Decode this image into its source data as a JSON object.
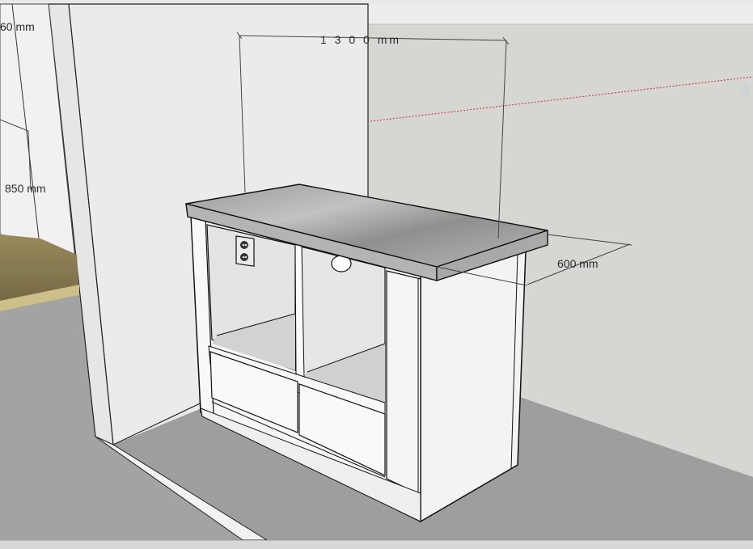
{
  "dimensions": {
    "width_label": "1 3 0 0 mm",
    "depth_label": "600 mm",
    "height_label": "850 mm",
    "partial_label": "60 mm"
  },
  "colors": {
    "wall_back": "#d4d4d0",
    "wall_left": "#e8e8e8",
    "floor": "#9d9d9d",
    "countertop": "#a8a8a8",
    "cabinet_body": "#f4f4f4",
    "wood_floor": "#8a7a4e",
    "axis_red": "#c83232"
  },
  "icons": {
    "outlet": "power-outlet-icon"
  }
}
